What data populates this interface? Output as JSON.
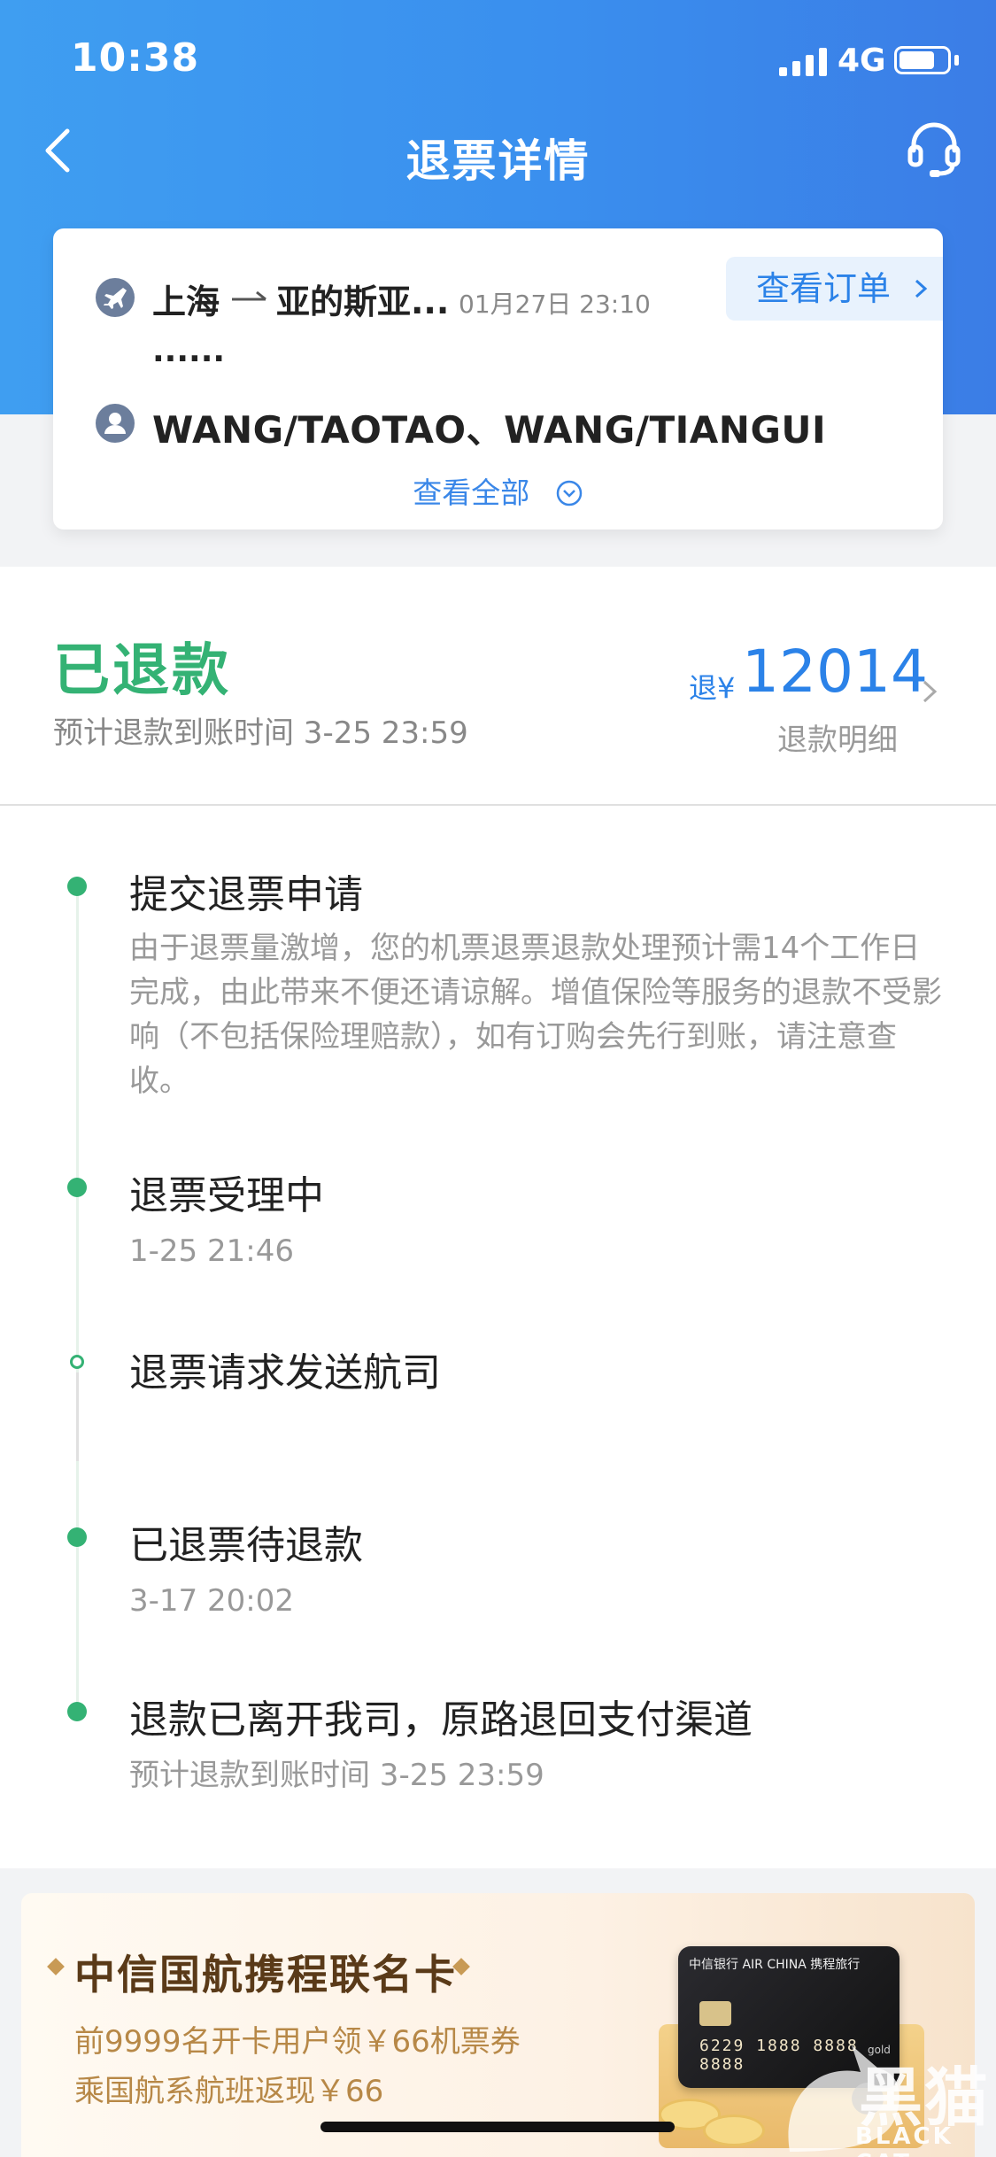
{
  "status_bar": {
    "time": "10:38",
    "network": "4G",
    "battery_level": 0.75
  },
  "nav": {
    "title": "退票详情",
    "back_icon": "chevron-left-icon",
    "service_icon": "headset-icon"
  },
  "order": {
    "from": "上海",
    "to": "亚的斯亚...",
    "datetime": "01月27日 23:10",
    "view_order_label": "查看订单",
    "ellipsis": "......",
    "passengers": "WANG/TAOTAO、WANG/TIANGUI",
    "view_all_label": "查看全部"
  },
  "refund": {
    "status": "已退款",
    "eta": "预计退款到账时间 3-25 23:59",
    "amount_prefix": "退¥",
    "amount": "12014",
    "detail_link": "退款明细",
    "status_color": "#34b274",
    "accent_color": "#2b82e8"
  },
  "timeline": [
    {
      "title": "提交退票申请",
      "desc": "由于退票量激增，您的机票退票退款处理预计需14个工作日完成，由此带来不便还请谅解。增值保险等服务的退款不受影响（不包括保险理赔款），如有订购会先行到账，请注意查收。"
    },
    {
      "title": "退票受理中",
      "desc": "1-25 21:46"
    },
    {
      "title": "退票请求发送航司",
      "desc": ""
    },
    {
      "title": "已退票待退款",
      "desc": "3-17 20:02"
    },
    {
      "title": "退款已离开我司，原路退回支付渠道",
      "desc": "预计退款到账时间 3-25 23:59"
    }
  ],
  "banner": {
    "title": "中信国航携程联名卡",
    "line1": "前9999名开卡用户领￥66机票券",
    "line2": "乘国航系航班返现￥66",
    "card_number": "6229 1888 8888 8888",
    "card_brand": "中信银行 AIR CHINA 携程旅行",
    "card_tier": "gold"
  },
  "watermark": {
    "text": "黑猫",
    "sub": "BLACK CAT"
  }
}
